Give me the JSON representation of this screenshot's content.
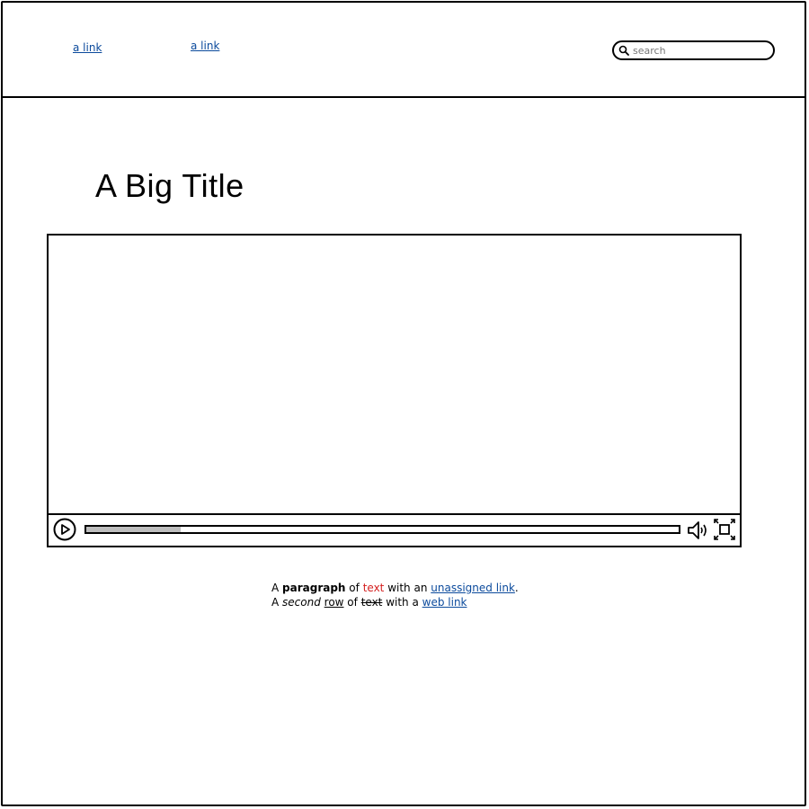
{
  "header": {
    "links": [
      "a link",
      "a link"
    ],
    "search": {
      "placeholder": "search",
      "value": ""
    }
  },
  "title": "A Big Title",
  "video": {
    "progress": 0.16
  },
  "paragraph": {
    "line1": {
      "t1": "A ",
      "bold": "paragraph",
      "t2": " of ",
      "red": "text",
      "t3": " with an ",
      "link": "unassigned link",
      "t4": "."
    },
    "line2": {
      "t1": "A ",
      "italic": "second",
      "t2": " ",
      "underline": "row",
      "t3": " of ",
      "strike": "text",
      "t4": " with a ",
      "link": "web link"
    }
  },
  "colors": {
    "link": "#0b4a9c",
    "red_text": "#d42020",
    "progress_fill": "#bdbdbd"
  }
}
